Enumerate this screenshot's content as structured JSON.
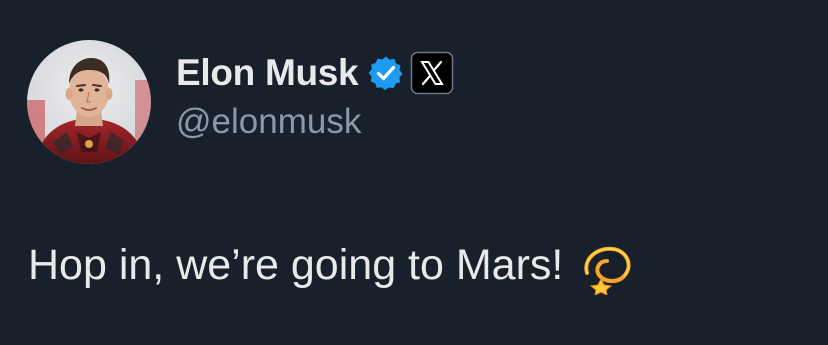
{
  "author": {
    "display_name": "Elon Musk",
    "handle": "@elonmusk",
    "verified_badge_icon": "verified-check-icon",
    "affiliation_icon": "x-logo-icon",
    "verified_color": "#1d9bf0"
  },
  "tweet": {
    "text": "Hop in, we’re going to Mars!",
    "emoji_icon": "dizzy-emoji-icon"
  },
  "colors": {
    "background": "#18202b",
    "primary_text": "#e7e9ea",
    "secondary_text": "#8b98a5"
  }
}
